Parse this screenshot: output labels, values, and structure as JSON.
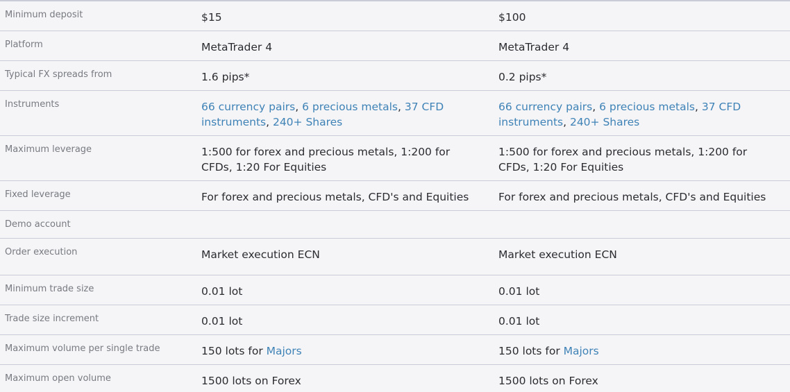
{
  "rows": [
    {
      "label": "Minimum deposit",
      "col1": "$15",
      "col2": "$100"
    },
    {
      "label": "Platform",
      "col1": "MetaTrader 4",
      "col2": "MetaTrader 4"
    },
    {
      "label": "Typical FX spreads from",
      "col1": "1.6 pips*",
      "col2": "0.2 pips*"
    },
    {
      "label": "Instruments",
      "col1": {
        "l1": "66 currency pairs",
        "s1": ", ",
        "l2": "6 precious metals",
        "s2": ", ",
        "l3": "37 CFD instruments",
        "s3": ", ",
        "l4": "240+ Shares"
      },
      "col2": {
        "l1": "66 currency pairs",
        "s1": ", ",
        "l2": "6 precious metals",
        "s2": ", ",
        "l3": "37 CFD instruments",
        "s3": ", ",
        "l4": "240+ Shares"
      }
    },
    {
      "label": "Maximum leverage",
      "col1": "1:500 for forex and precious metals, 1:200 for CFDs, 1:20 For Equities",
      "col2": "1:500 for forex and precious metals, 1:200 for CFDs, 1:20 For Equities"
    },
    {
      "label": "Fixed leverage",
      "col1": "For forex and precious metals, CFD's and Equities",
      "col2": "For forex and precious metals, CFD's and Equities"
    },
    {
      "label": "Demo account",
      "col1": "",
      "col2": ""
    },
    {
      "label": "Order execution",
      "col1": "Market execution ECN",
      "col2": "Market execution ECN"
    },
    {
      "label": "Minimum trade size",
      "col1": "0.01 lot",
      "col2": "0.01 lot"
    },
    {
      "label": "Trade size increment",
      "col1": "0.01 lot",
      "col2": "0.01 lot"
    },
    {
      "label": "Maximum volume per single trade",
      "col1": {
        "pre": "150 lots for ",
        "link": "Majors"
      },
      "col2": {
        "pre": "150 lots for ",
        "link": "Majors"
      }
    },
    {
      "label": "Maximum open volume",
      "col1": "1500 lots on Forex",
      "col2": "1500 lots on Forex"
    }
  ],
  "colors": {
    "link": "#3e82b6",
    "label": "#777a80",
    "value": "#2b2c30",
    "border": "#c9ccd6",
    "background": "#f5f5f7"
  }
}
